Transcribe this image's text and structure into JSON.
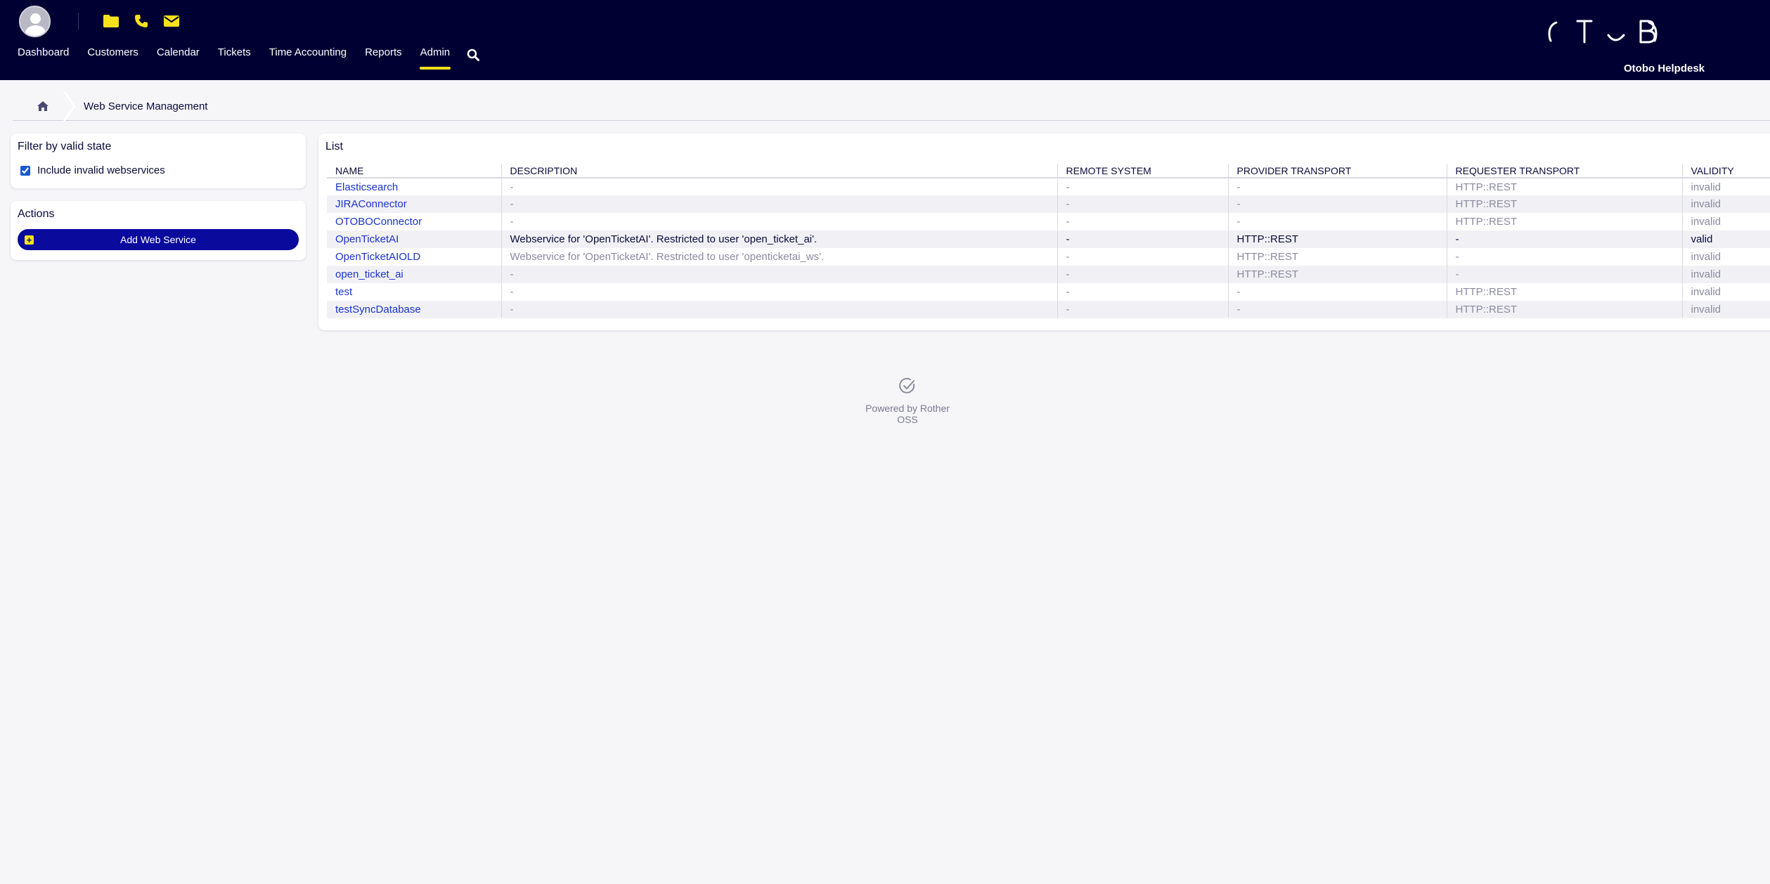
{
  "header": {
    "nav": [
      "Dashboard",
      "Customers",
      "Calendar",
      "Tickets",
      "Time Accounting",
      "Reports",
      "Admin"
    ],
    "active_nav": "Admin",
    "brand": "Otobo Helpdesk",
    "accent_color": "#f7e21a",
    "background_color": "#000033",
    "icons": [
      "avatar",
      "folder-icon",
      "phone-icon",
      "envelope-icon",
      "search-icon"
    ]
  },
  "breadcrumb": {
    "current": "Web Service Management"
  },
  "filter": {
    "title": "Filter by valid state",
    "checkbox_label": "Include invalid webservices",
    "checked": true
  },
  "actions": {
    "title": "Actions",
    "add_button": "Add Web Service"
  },
  "list": {
    "title": "List",
    "columns": [
      "NAME",
      "DESCRIPTION",
      "REMOTE SYSTEM",
      "PROVIDER TRANSPORT",
      "REQUESTER TRANSPORT",
      "VALIDITY"
    ],
    "rows": [
      {
        "name": "Elasticsearch",
        "description": "-",
        "remote": "-",
        "provider": "-",
        "requester": "HTTP::REST",
        "validity": "invalid"
      },
      {
        "name": "JIRAConnector",
        "description": "-",
        "remote": "-",
        "provider": "-",
        "requester": "HTTP::REST",
        "validity": "invalid"
      },
      {
        "name": "OTOBOConnector",
        "description": "-",
        "remote": "-",
        "provider": "-",
        "requester": "HTTP::REST",
        "validity": "invalid"
      },
      {
        "name": "OpenTicketAI",
        "description": "Webservice for 'OpenTicketAI'. Restricted to user 'open_ticket_ai'.",
        "remote": "-",
        "provider": "HTTP::REST",
        "requester": "-",
        "validity": "valid"
      },
      {
        "name": "OpenTicketAIOLD",
        "description": "Webservice for 'OpenTicketAI'. Restricted to user 'openticketai_ws'.",
        "remote": "-",
        "provider": "HTTP::REST",
        "requester": "-",
        "validity": "invalid"
      },
      {
        "name": "open_ticket_ai",
        "description": "-",
        "remote": "-",
        "provider": "HTTP::REST",
        "requester": "-",
        "validity": "invalid"
      },
      {
        "name": "test",
        "description": "-",
        "remote": "-",
        "provider": "-",
        "requester": "HTTP::REST",
        "validity": "invalid"
      },
      {
        "name": "testSyncDatabase",
        "description": "-",
        "remote": "-",
        "provider": "-",
        "requester": "HTTP::REST",
        "validity": "invalid"
      }
    ]
  },
  "footer": {
    "text": "Powered by Rother OSS"
  }
}
